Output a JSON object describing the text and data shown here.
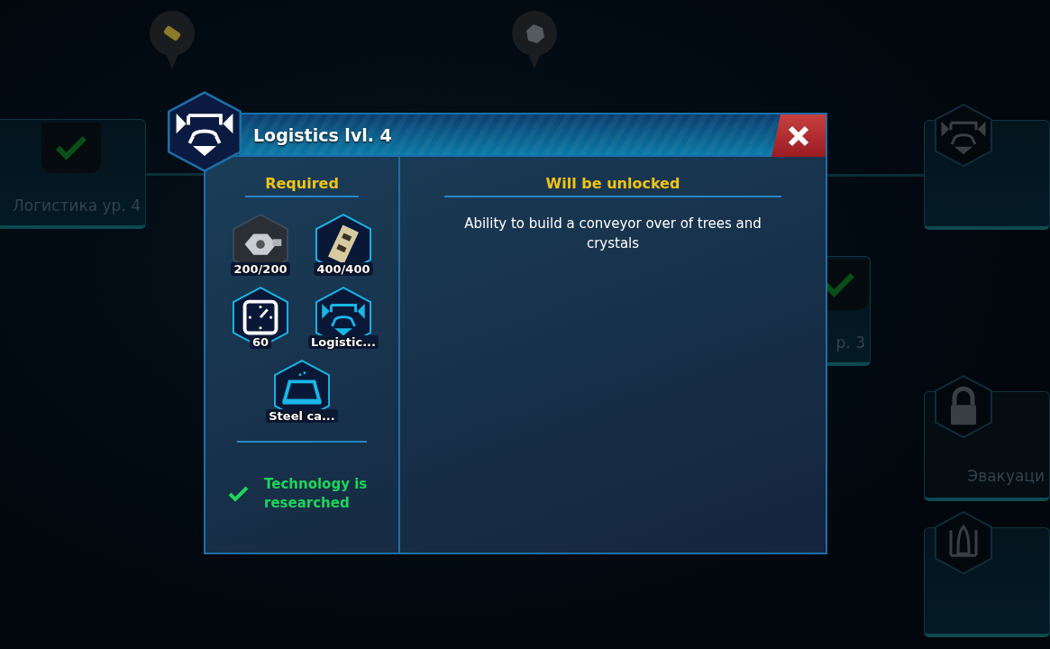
{
  "tree": {
    "nodes": [
      {
        "kind": "researched",
        "label": "Логистика ур. 4"
      },
      {
        "kind": "researched",
        "label": "р. 3"
      },
      {
        "kind": "robot"
      },
      {
        "kind": "locked",
        "label": "Эвакуаци"
      },
      {
        "kind": "rocket"
      }
    ],
    "pins": [
      {
        "kind": "battery"
      },
      {
        "kind": "rock"
      }
    ]
  },
  "dialog": {
    "title": "Logistics lvl. 4",
    "required_heading": "Required",
    "requirements": [
      {
        "kind": "gear",
        "label": "200/200"
      },
      {
        "kind": "plate",
        "label": "400/400"
      },
      {
        "kind": "time",
        "label": "60"
      },
      {
        "kind": "robot",
        "label": "Logistic..."
      },
      {
        "kind": "crucible",
        "label": "Steel ca..."
      }
    ],
    "status": {
      "researched": true,
      "text": "Technology is researched"
    },
    "unlocked_heading": "Will be unlocked",
    "unlocks": [
      "Ability to build a conveyor over of trees and crystals"
    ]
  }
}
